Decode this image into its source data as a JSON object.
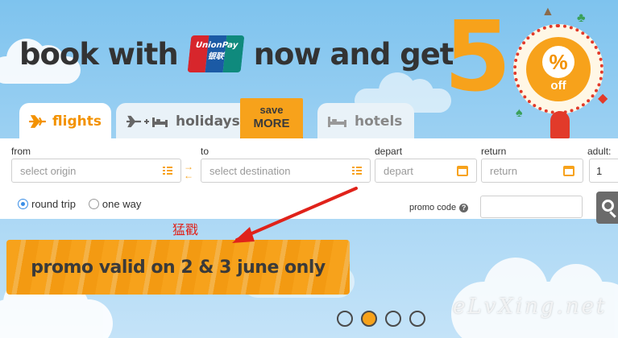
{
  "headline": {
    "before": "book with",
    "after": "now and get",
    "unionpay_line1": "UnionPay",
    "unionpay_line2": "银联"
  },
  "offer": {
    "digit": "5",
    "percent": "%",
    "off": "off"
  },
  "tabs": [
    {
      "label": "flights",
      "icon": "airplane-icon"
    },
    {
      "label": "holidays",
      "icon": "plane-plus-bed-icon"
    },
    {
      "label": "hotels",
      "icon": "bed-icon"
    }
  ],
  "save_badge": {
    "line1": "save",
    "line2": "MORE"
  },
  "search_form": {
    "from_label": "from",
    "from_placeholder": "select origin",
    "to_label": "to",
    "to_placeholder": "select destination",
    "depart_label": "depart",
    "depart_placeholder": "depart",
    "return_label": "return",
    "return_placeholder": "return",
    "adult_label": "adult:",
    "adult_value": "1",
    "trip_types": [
      "round trip",
      "one way"
    ],
    "selected_trip": "round trip",
    "promo_label": "promo code",
    "help_glyph": "?"
  },
  "promo_banner": "promo valid on 2 & 3 june only",
  "annotation": "猛戳",
  "pagination": {
    "count": 4,
    "active_index": 1
  },
  "watermark": "eLvXing.net",
  "colors": {
    "accent": "#f7a21b",
    "annotation_red": "#e0221a",
    "radio_blue": "#3a8ee6"
  }
}
